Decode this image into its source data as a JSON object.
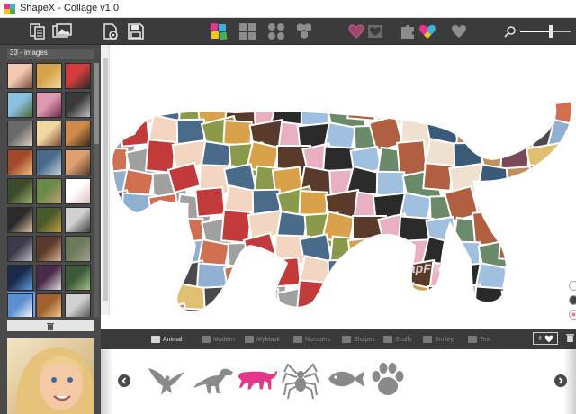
{
  "window": {
    "title": "ShapeX - Collage v1.0"
  },
  "toolbar": {
    "buttons": [
      {
        "name": "copy-pages-icon"
      },
      {
        "name": "open-images-icon"
      },
      {
        "name": "save-image-settings-icon"
      },
      {
        "name": "save-icon"
      },
      {
        "name": "shape-layout-icon"
      },
      {
        "name": "grid-layout-icon"
      },
      {
        "name": "circle-layout-icon"
      },
      {
        "name": "hexagon-layout-icon"
      },
      {
        "name": "heart-outline-icon"
      },
      {
        "name": "heart-frame-icon"
      },
      {
        "name": "puzzle-icon"
      },
      {
        "name": "color-heart-icon"
      },
      {
        "name": "heart-solid-icon"
      },
      {
        "name": "zoom-icon"
      }
    ],
    "zoom_level": 0.6
  },
  "left_panel": {
    "image_count_label": "33 - images",
    "scroll_position": 0.0
  },
  "canvas": {
    "watermark": "SnapFiles",
    "background_options": [
      "white",
      "dark",
      "pattern"
    ]
  },
  "categories": {
    "items": [
      "Animal",
      "Modern",
      "MyMask",
      "Numbers",
      "Shapes",
      "Sculls",
      "Smiley",
      "Text"
    ],
    "active": "Animal",
    "add_label": "+"
  },
  "shapes": {
    "items": [
      "eagle",
      "dinosaur",
      "panther",
      "spider",
      "fish",
      "paw"
    ],
    "selected": "panther",
    "colors": {
      "default": "#8a8a8a",
      "selected": "#e6358a"
    }
  },
  "colors": {
    "accent": "#e6358a",
    "toolbar": "#3b3b3b",
    "panel": "#4a4a4a"
  }
}
